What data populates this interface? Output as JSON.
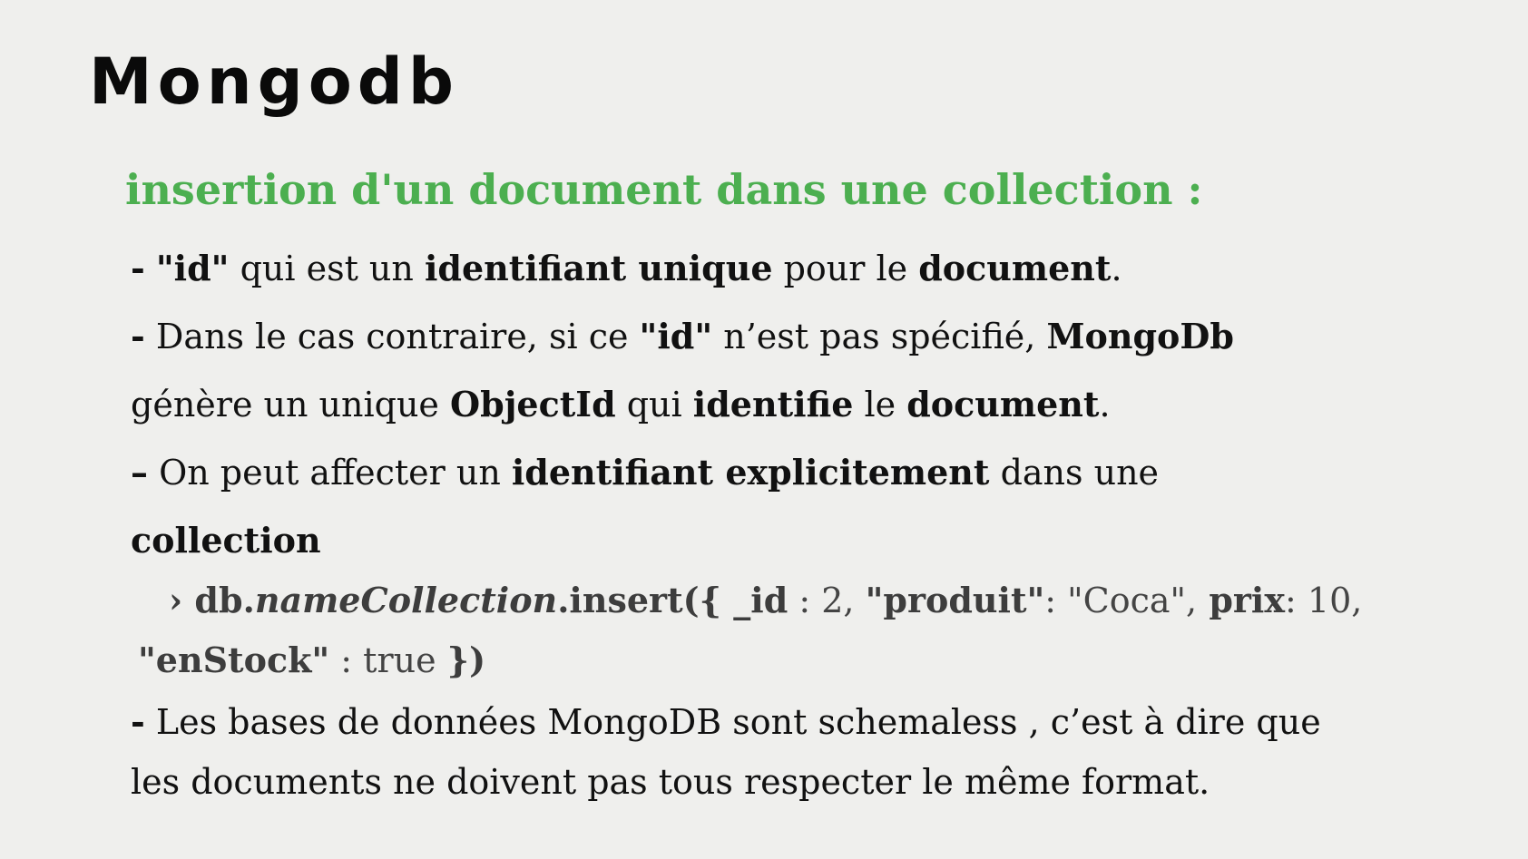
{
  "slide": {
    "title": "Mongodb",
    "subtitle": "insertion d'un document dans une collection :"
  },
  "lines": {
    "l1": {
      "dash": "-",
      "b1": "\"id\"",
      "t1": " qui est un ",
      "b2": "identifiant unique",
      "t2": " pour le ",
      "b3": "document",
      "t3": "."
    },
    "l2": {
      "dash": "-",
      "t1": " Dans le cas contraire, si ce ",
      "b1": "\"id\"",
      "t2": " n’est pas spécifié, ",
      "b2": "MongoDb"
    },
    "l3": {
      "t1": "génère un unique ",
      "b1": "ObjectId",
      "t2": " qui ",
      "b2": "identifie",
      "t3": " le ",
      "b3": "document",
      "t4": "."
    },
    "l4": {
      "dash": "–",
      "t1": " On peut affecter un ",
      "b1": "identifiant explicitement",
      "t2": " dans une"
    },
    "l5": {
      "b1": "collection"
    },
    "code1": {
      "prompt": "›",
      "b1": " db.",
      "i1": "nameCollection",
      "b2": ".insert({ _id",
      "t1": " : 2, ",
      "b3": "\"produit\"",
      "t2": ": \"Coca\",",
      "b4": " prix",
      "t3": ": 10,"
    },
    "code2": {
      "b1": "\"enStock\"",
      "t1": " : true ",
      "b2": "})"
    },
    "l6": {
      "dash": "-",
      "t1": " Les bases de données MongoDB sont schemaless , c’est à dire que"
    },
    "l7": {
      "t1": "les documents ne doivent pas tous respecter le même format."
    }
  }
}
